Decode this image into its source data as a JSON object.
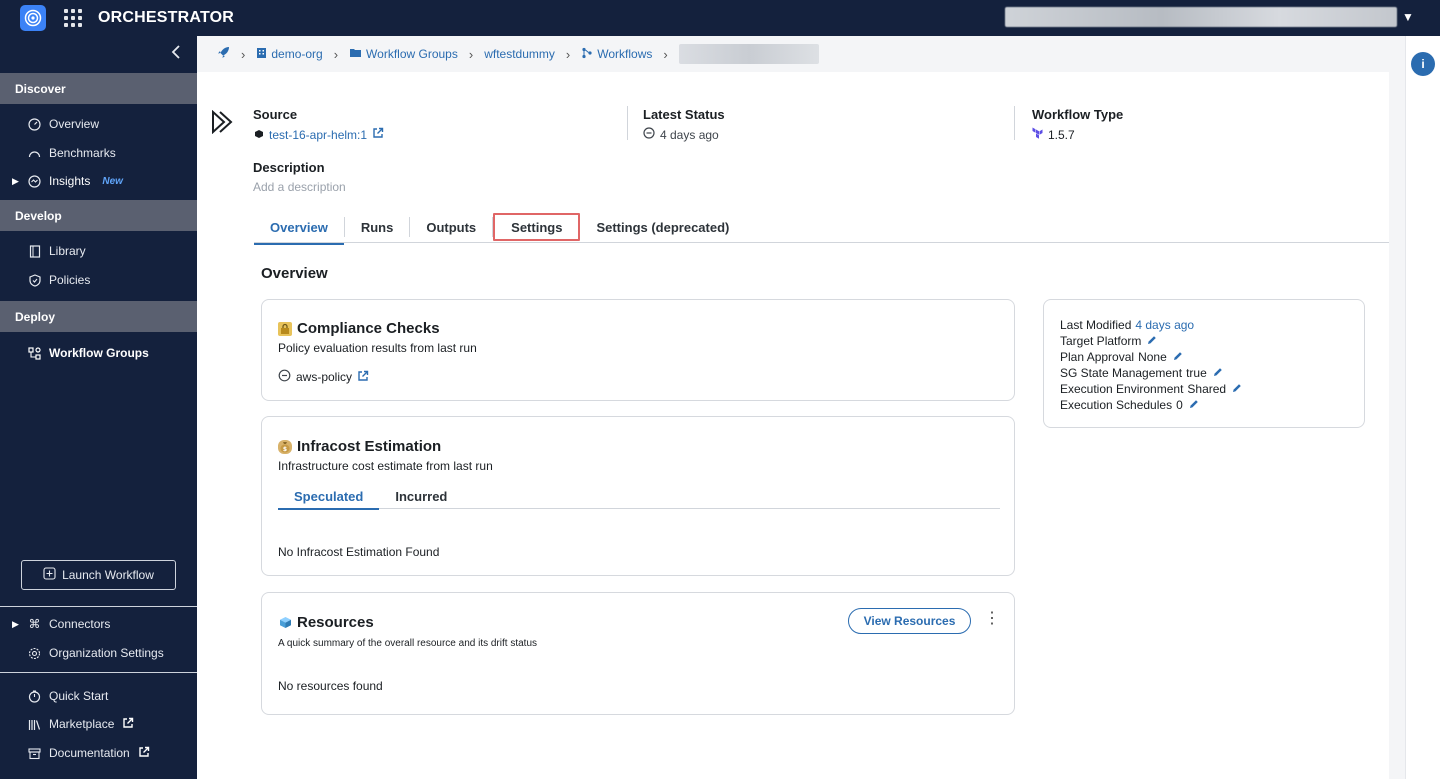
{
  "app": {
    "title": "ORCHESTRATOR"
  },
  "sidebar": {
    "sections": [
      {
        "label": "Discover"
      },
      {
        "label": "Develop"
      },
      {
        "label": "Deploy"
      }
    ],
    "discover": {
      "overview": "Overview",
      "benchmarks": "Benchmarks",
      "insights": "Insights",
      "insights_badge": "New"
    },
    "develop": {
      "library": "Library",
      "policies": "Policies"
    },
    "deploy": {
      "workflow_groups": "Workflow Groups"
    },
    "launch_button": "Launch Workflow",
    "connectors": "Connectors",
    "org_settings": "Organization Settings",
    "quick_start": "Quick Start",
    "marketplace": "Marketplace",
    "documentation": "Documentation"
  },
  "breadcrumb": [
    "demo-org",
    "Workflow Groups",
    "wftestdummy",
    "Workflows"
  ],
  "workflow": {
    "source_label": "Source",
    "source_value": "test-16-apr-helm:1",
    "status_label": "Latest Status",
    "status_value": "4 days ago",
    "type_label": "Workflow Type",
    "type_value": "1.5.7",
    "description_label": "Description",
    "description_placeholder": "Add a description"
  },
  "tabs": [
    "Overview",
    "Runs",
    "Outputs",
    "Settings",
    "Settings (deprecated)"
  ],
  "overview": {
    "title": "Overview",
    "compliance": {
      "title": "Compliance Checks",
      "subtitle": "Policy evaluation results from last run",
      "policy": "aws-policy"
    },
    "infracost": {
      "title": "Infracost Estimation",
      "subtitle": "Infrastructure cost estimate from last run",
      "tabs": [
        "Speculated",
        "Incurred"
      ],
      "empty": "No Infracost Estimation Found"
    },
    "resources": {
      "title": "Resources",
      "subtitle": "A quick summary of the overall resource and its drift status",
      "button": "View Resources",
      "empty": "No resources found"
    }
  },
  "details": {
    "last_modified_label": "Last Modified",
    "last_modified_value": "4 days ago",
    "target_platform_label": "Target Platform",
    "plan_approval_label": "Plan Approval",
    "plan_approval_value": "None",
    "sg_state_label": "SG State Management",
    "sg_state_value": "true",
    "exec_env_label": "Execution Environment",
    "exec_env_value": "Shared",
    "exec_sched_label": "Execution Schedules",
    "exec_sched_value": "0"
  },
  "colors": {
    "sidebar": "#14213d",
    "accent": "#2b6cb0",
    "highlight_box": "#e06666"
  }
}
